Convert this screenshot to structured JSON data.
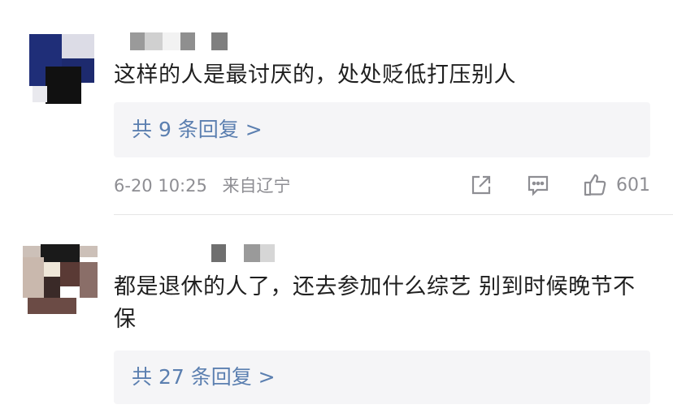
{
  "comments": [
    {
      "content": "这样的人是最讨厌的，处处贬低打压别人",
      "replies_label": "共 9 条回复 >",
      "date": "6-20 10:25",
      "location": "来自辽宁",
      "likes": "601"
    },
    {
      "content": "都是退休的人了，还去参加什么综艺  别到时候晚节不保",
      "replies_label": "共 27 条回复 >"
    }
  ],
  "icons": {
    "share": "share-icon",
    "comment": "comment-icon",
    "like": "thumbs-up-icon"
  },
  "colors": {
    "link": "#5b7fb0",
    "meta": "#8e8e93",
    "reply_bg": "#f5f5f7"
  }
}
